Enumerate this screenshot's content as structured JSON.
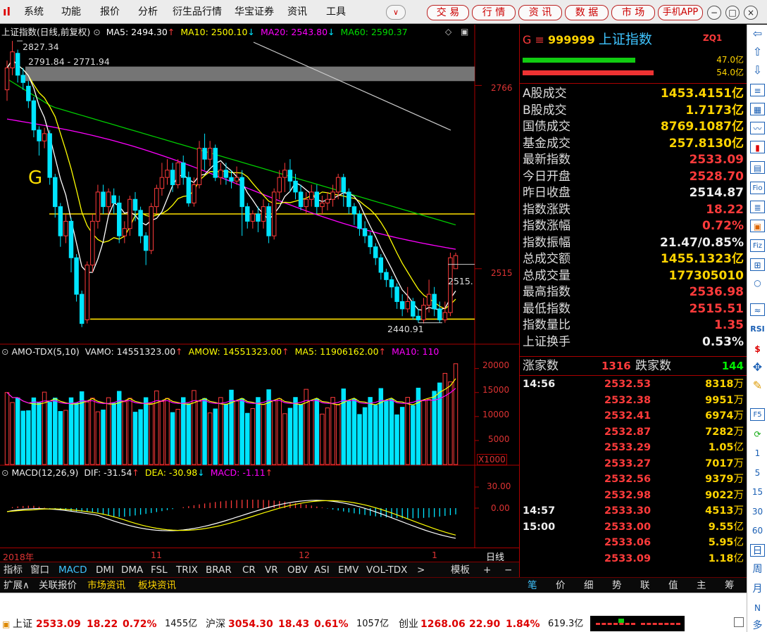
{
  "menu": {
    "items": [
      "系统",
      "功能",
      "报价",
      "分析",
      "衍生品行情",
      "华宝证券",
      "资讯",
      "工具"
    ],
    "dropdown_glyph": "∨",
    "pills": [
      "交 易",
      "行 情",
      "资 讯",
      "数 据",
      "市 场",
      "手机APP"
    ]
  },
  "main_chart": {
    "title": "上证指数(日线,前复权)",
    "ma5": "MA5: 2494.30",
    "ma10": "MA10: 2500.10",
    "ma20": "MA20: 2543.80",
    "ma60": "MA60: 2590.37",
    "arrow_up": "↑",
    "arrow_down": "↓",
    "label_g": "G",
    "high_label": "2827.34",
    "range_label": "2791.84 - 2771.94",
    "low_label": "2440.91",
    "last_label": "2515.",
    "y_2766": "2766",
    "y_2515": "2515"
  },
  "volume_chart": {
    "title": "AMO-TDX(5,10)",
    "vamo": "VAMO: 14551323.00",
    "amow": "AMOW: 14551323.00",
    "ma5": "MA5: 11906162.00",
    "ma10": "MA10: 110",
    "y_labels": [
      "20000",
      "15000",
      "10000",
      "5000"
    ],
    "unit": "X1000"
  },
  "macd_chart": {
    "title": "MACD(12,26,9)",
    "dif": "DIF: -31.54",
    "dea": "DEA: -30.98",
    "macd": "MACD: -1.11",
    "y_labels": [
      "30.00",
      "0.00"
    ]
  },
  "time_axis": {
    "labels": [
      "2018年",
      "11",
      "12",
      "1"
    ],
    "period": "日线"
  },
  "indicator_tabs": [
    "指标",
    "窗口",
    "MACD",
    "DMI",
    "DMA",
    "FSL",
    "TRIX",
    "BRAR",
    "CR",
    "VR",
    "OBV",
    "ASI",
    "EMV",
    "VOL-TDX",
    ">",
    "模板",
    "+",
    "−"
  ],
  "lower_tabs": [
    "扩展∧",
    "关联报价",
    "市场资讯",
    "板块资讯"
  ],
  "quote": {
    "header_prefix": "G ≡",
    "code": "999999",
    "name": "上证指数",
    "tag": "ZQ1",
    "bar_top_value": "47.0亿",
    "bar_bottom_value": "54.0亿",
    "rows": [
      {
        "k": "A股成交",
        "v": "1453.4151亿",
        "c": "#ffd400"
      },
      {
        "k": "B股成交",
        "v": "1.7173亿",
        "c": "#ffd400"
      },
      {
        "k": "国债成交",
        "v": "8769.1087亿",
        "c": "#ffd400"
      },
      {
        "k": "基金成交",
        "v": "257.8130亿",
        "c": "#ffd400"
      },
      {
        "k": "最新指数",
        "v": "2533.09",
        "c": "#ff3b3b"
      },
      {
        "k": "今日开盘",
        "v": "2528.70",
        "c": "#ff3b3b"
      },
      {
        "k": "昨日收盘",
        "v": "2514.87",
        "c": "#eeeeee"
      },
      {
        "k": "指数涨跌",
        "v": "18.22",
        "c": "#ff3b3b"
      },
      {
        "k": "指数涨幅",
        "v": "0.72%",
        "c": "#ff3b3b"
      },
      {
        "k": "指数振幅",
        "v": "21.47/0.85%",
        "c": "#eeeeee"
      },
      {
        "k": "总成交额",
        "v": "1455.1323亿",
        "c": "#ffd400"
      },
      {
        "k": "总成交量",
        "v": "177305010",
        "c": "#ffd400"
      },
      {
        "k": "最高指数",
        "v": "2536.98",
        "c": "#ff3b3b"
      },
      {
        "k": "最低指数",
        "v": "2515.51",
        "c": "#ff3b3b"
      },
      {
        "k": "指数量比",
        "v": "1.35",
        "c": "#ff3b3b"
      },
      {
        "k": "上证换手",
        "v": "0.53%",
        "c": "#eeeeee"
      }
    ],
    "up_label": "涨家数",
    "up_count": "1316",
    "down_label": "跌家数",
    "down_count": "144"
  },
  "ticks": [
    {
      "t": "14:56",
      "p": "2532.53",
      "v": "8318",
      "u": "万"
    },
    {
      "t": "",
      "p": "2532.38",
      "v": "9951",
      "u": "万"
    },
    {
      "t": "",
      "p": "2532.41",
      "v": "6974",
      "u": "万"
    },
    {
      "t": "",
      "p": "2532.87",
      "v": "7282",
      "u": "万"
    },
    {
      "t": "",
      "p": "2533.29",
      "v": "1.05",
      "u": "亿"
    },
    {
      "t": "",
      "p": "2533.27",
      "v": "7017",
      "u": "万"
    },
    {
      "t": "",
      "p": "2532.56",
      "v": "9379",
      "u": "万"
    },
    {
      "t": "",
      "p": "2532.98",
      "v": "9022",
      "u": "万"
    },
    {
      "t": "14:57",
      "p": "2533.30",
      "v": "4513",
      "u": "万"
    },
    {
      "t": "15:00",
      "p": "2533.00",
      "v": "9.55",
      "u": "亿"
    },
    {
      "t": "",
      "p": "2533.06",
      "v": "5.95",
      "u": "亿"
    },
    {
      "t": "",
      "p": "2533.09",
      "v": "1.18",
      "u": "亿"
    }
  ],
  "right_tabs": [
    "笔",
    "价",
    "细",
    "势",
    "联",
    "值",
    "主",
    "筹"
  ],
  "toolbar_text": [
    "Fio",
    "Fiz",
    "RSI",
    "F5",
    "1",
    "5",
    "15",
    "30",
    "60",
    "日",
    "周",
    "月",
    "N",
    "多"
  ],
  "status": {
    "sh_label": "上证",
    "sh_price": "2533.09",
    "sh_chg": "18.22",
    "sh_pct": "0.72%",
    "sh_amt": "1455亿",
    "hs_label": "沪深",
    "hs_price": "3054.30",
    "hs_chg": "18.43",
    "hs_pct": "0.61%",
    "hs_amt": "1057亿",
    "cy_label": "创业",
    "cy_price": "1268.06",
    "cy_chg": "22.90",
    "cy_pct": "1.84%",
    "cy_amt": "619.3亿"
  },
  "colors": {
    "up": "#ff3b3b",
    "down": "#00e5ff",
    "ma5": "#ffffff",
    "ma10": "#ffff00",
    "ma20": "#ff00ff",
    "ma60": "#00cc00",
    "frame": "#aa0000"
  },
  "candles": [
    [
      2760,
      2790,
      2745,
      2800
    ],
    [
      2790,
      2812,
      2780,
      2827
    ],
    [
      2810,
      2780,
      2770,
      2815
    ],
    [
      2780,
      2770,
      2760,
      2790
    ],
    [
      2765,
      2745,
      2735,
      2772
    ],
    [
      2745,
      2705,
      2695,
      2750
    ],
    [
      2705,
      2690,
      2670,
      2710
    ],
    [
      2690,
      2700,
      2680,
      2708
    ],
    [
      2700,
      2640,
      2630,
      2705
    ],
    [
      2640,
      2600,
      2585,
      2645
    ],
    [
      2600,
      2560,
      2545,
      2605
    ],
    [
      2560,
      2580,
      2550,
      2590
    ],
    [
      2580,
      2530,
      2510,
      2585
    ],
    [
      2530,
      2480,
      2470,
      2535
    ],
    [
      2480,
      2440,
      2435,
      2485
    ],
    [
      2445,
      2520,
      2440,
      2525
    ],
    [
      2520,
      2580,
      2510,
      2590
    ],
    [
      2580,
      2620,
      2570,
      2630
    ],
    [
      2620,
      2600,
      2590,
      2630
    ],
    [
      2600,
      2620,
      2590,
      2625
    ],
    [
      2615,
      2605,
      2590,
      2625
    ],
    [
      2605,
      2560,
      2550,
      2615
    ],
    [
      2560,
      2570,
      2550,
      2580
    ],
    [
      2570,
      2610,
      2560,
      2615
    ],
    [
      2610,
      2595,
      2580,
      2620
    ],
    [
      2595,
      2560,
      2550,
      2600
    ],
    [
      2560,
      2540,
      2520,
      2565
    ],
    [
      2540,
      2600,
      2535,
      2605
    ],
    [
      2600,
      2625,
      2590,
      2630
    ],
    [
      2625,
      2640,
      2615,
      2660
    ],
    [
      2640,
      2650,
      2630,
      2665
    ],
    [
      2650,
      2630,
      2620,
      2660
    ],
    [
      2630,
      2660,
      2625,
      2665
    ],
    [
      2660,
      2640,
      2630,
      2670
    ],
    [
      2640,
      2605,
      2600,
      2648
    ],
    [
      2605,
      2630,
      2600,
      2640
    ],
    [
      2630,
      2680,
      2625,
      2690
    ],
    [
      2680,
      2665,
      2650,
      2700
    ],
    [
      2665,
      2680,
      2655,
      2690
    ],
    [
      2680,
      2640,
      2635,
      2685
    ],
    [
      2640,
      2650,
      2630,
      2660
    ],
    [
      2650,
      2640,
      2630,
      2660
    ],
    [
      2640,
      2635,
      2625,
      2650
    ],
    [
      2635,
      2640,
      2630,
      2655
    ],
    [
      2640,
      2600,
      2560,
      2650
    ],
    [
      2600,
      2580,
      2570,
      2605
    ],
    [
      2580,
      2590,
      2570,
      2595
    ],
    [
      2590,
      2580,
      2565,
      2600
    ],
    [
      2580,
      2600,
      2570,
      2610
    ],
    [
      2600,
      2560,
      2550,
      2605
    ],
    [
      2560,
      2620,
      2555,
      2625
    ],
    [
      2620,
      2640,
      2610,
      2650
    ],
    [
      2640,
      2650,
      2620,
      2660
    ],
    [
      2650,
      2635,
      2620,
      2665
    ],
    [
      2635,
      2620,
      2610,
      2645
    ],
    [
      2620,
      2600,
      2595,
      2630
    ],
    [
      2600,
      2610,
      2590,
      2620
    ],
    [
      2610,
      2620,
      2600,
      2630
    ],
    [
      2620,
      2600,
      2590,
      2630
    ],
    [
      2600,
      2605,
      2590,
      2615
    ],
    [
      2605,
      2610,
      2595,
      2620
    ],
    [
      2610,
      2620,
      2600,
      2630
    ],
    [
      2620,
      2640,
      2610,
      2645
    ],
    [
      2640,
      2620,
      2600,
      2645
    ],
    [
      2620,
      2600,
      2590,
      2625
    ],
    [
      2600,
      2590,
      2575,
      2605
    ],
    [
      2590,
      2570,
      2560,
      2595
    ],
    [
      2570,
      2560,
      2550,
      2580
    ],
    [
      2560,
      2545,
      2535,
      2565
    ],
    [
      2545,
      2530,
      2520,
      2550
    ],
    [
      2530,
      2510,
      2500,
      2535
    ],
    [
      2510,
      2500,
      2490,
      2515
    ],
    [
      2500,
      2490,
      2475,
      2505
    ],
    [
      2490,
      2470,
      2460,
      2495
    ],
    [
      2470,
      2460,
      2450,
      2480
    ],
    [
      2460,
      2470,
      2455,
      2490
    ],
    [
      2470,
      2450,
      2445,
      2475
    ],
    [
      2450,
      2445,
      2441,
      2460
    ],
    [
      2445,
      2465,
      2440,
      2475
    ],
    [
      2465,
      2480,
      2455,
      2500
    ],
    [
      2480,
      2460,
      2450,
      2490
    ],
    [
      2460,
      2445,
      2441,
      2470
    ],
    [
      2445,
      2455,
      2441,
      2470
    ],
    [
      2455,
      2530,
      2450,
      2537
    ],
    [
      2515,
      2533,
      2515,
      2537
    ]
  ]
}
